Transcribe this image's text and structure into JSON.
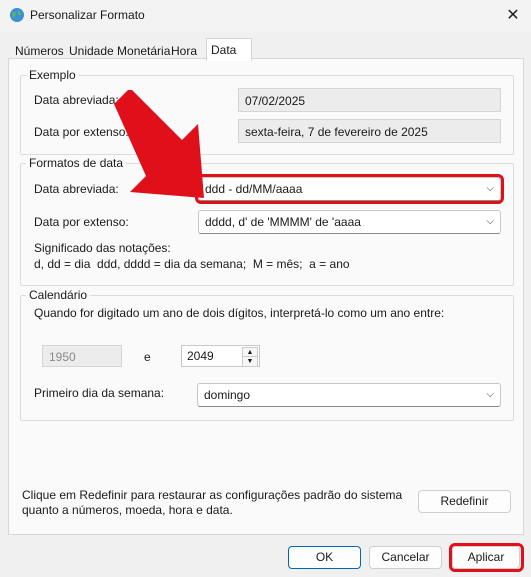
{
  "window": {
    "title": "Personalizar Formato",
    "icon": "globe-icon",
    "close_glyph": "✕"
  },
  "tabs": [
    {
      "label": "Números"
    },
    {
      "label": "Unidade Monetária"
    },
    {
      "label": "Hora"
    },
    {
      "label": "Data",
      "active": true
    }
  ],
  "example": {
    "legend": "Exemplo",
    "short_label": "Data abreviada:",
    "short_value": "07/02/2025",
    "long_label": "Data por extenso:",
    "long_value": "sexta-feira, 7 de fevereiro de 2025"
  },
  "formats": {
    "legend": "Formatos de data",
    "short_label": "Data abreviada:",
    "short_value": "ddd - dd/MM/aaaa",
    "long_label": "Data por extenso:",
    "long_value": "dddd, d' de 'MMMM' de 'aaaa",
    "notation_title": "Significado das notações:",
    "notation_text": "d, dd = dia  ddd, dddd = dia da semana;  M = mês;  a = ano"
  },
  "calendar": {
    "legend": "Calendário",
    "two_digit_text": "Quando for digitado um ano de dois dígitos, interpretá-lo como um ano entre:",
    "year_from": "1950",
    "and_label": "e",
    "year_to": "2049",
    "first_day_label": "Primeiro dia da semana:",
    "first_day_value": "domingo"
  },
  "reset": {
    "text_line1": "Clique em Redefinir para restaurar as configurações padrão do sistema",
    "text_line2": "quanto a números, moeda, hora e data.",
    "button": "Redefinir"
  },
  "footer": {
    "ok": "OK",
    "cancel": "Cancelar",
    "apply": "Aplicar"
  },
  "annotation": {
    "arrow_color": "#e0101a",
    "highlight_color": "#e0101a"
  }
}
